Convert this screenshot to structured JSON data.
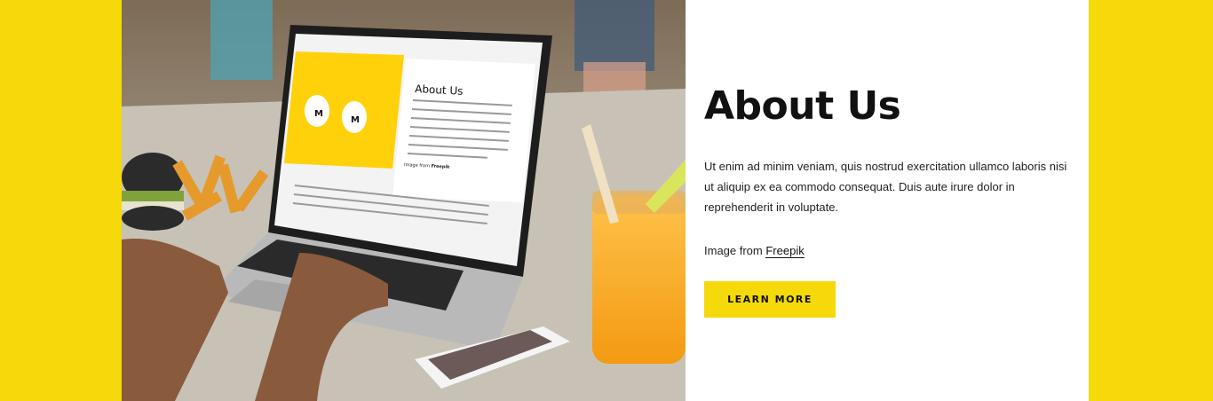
{
  "colors": {
    "accent": "#f5d90a",
    "panel": "#ffffff",
    "text": "#111111"
  },
  "about": {
    "title": "About Us",
    "paragraph": "Ut enim ad minim veniam, quis nostrud exercitation ullamco laboris nisi ut aliquip ex ea commodo consequat. Duis aute irure dolor in reprehenderit in voluptate.",
    "credit_prefix": "Image from ",
    "credit_link": "Freepik",
    "button_label": "LEARN MORE"
  },
  "laptop_screen": {
    "title": "About Us",
    "credit_prefix": "Image from ",
    "credit_link": "Freepik"
  }
}
